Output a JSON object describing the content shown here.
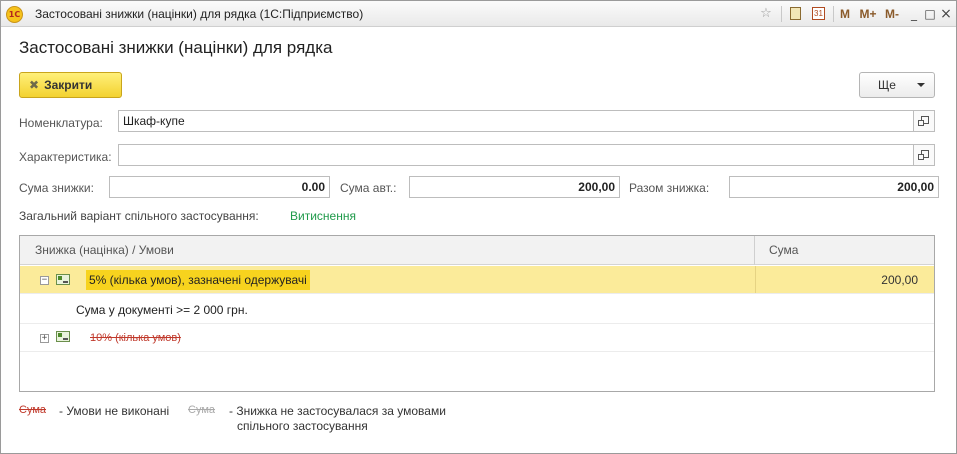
{
  "window": {
    "title": "Застосовані знижки (націнки) для рядка  (1С:Підприємство)",
    "app_logo_text": "1С",
    "toolbar": {
      "mem_m": "M",
      "mem_mplus": "M+",
      "mem_mminus": "M-",
      "minimize": "_",
      "maximize": "□",
      "close": "×",
      "calendar_day": "31"
    }
  },
  "form": {
    "title": "Застосовані знижки (націнки) для рядка",
    "close_button": "Закрити",
    "more_button": "Ще"
  },
  "fields": {
    "nomenclature_label": "Номенклатура:",
    "nomenclature_value": "Шкаф-купе",
    "characteristic_label": "Характеристика:",
    "characteristic_value": "",
    "discount_sum_label": "Сума знижки:",
    "discount_sum_value": "0.00",
    "auto_sum_label": "Сума авт.:",
    "auto_sum_value": "200,00",
    "total_discount_label": "Разом знижка:",
    "total_discount_value": "200,00",
    "joint_variant_label": "Загальний варіант спільного застосування:",
    "joint_variant_value": "Витиснення"
  },
  "table": {
    "columns": [
      "Знижка (націнка) / Умови",
      "Сума"
    ],
    "rows": [
      {
        "text": "5% (кілька умов), зазначені одержувачі",
        "sum": "200,00",
        "toggle": "−",
        "selected": true
      },
      {
        "text": "Сума у документі >= 2 000 грн.",
        "sum": ""
      },
      {
        "text": "10% (кілька умов)",
        "sum": "",
        "toggle": "+",
        "struck": true
      }
    ]
  },
  "legend": {
    "red_sample": "Сума",
    "red_text": "- Умови не виконані",
    "gray_sample": "Сума",
    "gray_text_line1": "- Знижка не застосувалася за умовами",
    "gray_text_line2": "спільного застосування"
  },
  "colors": {
    "accent_yellow": "#f3d230",
    "selection": "#fbeb9a",
    "highlight": "#f7d31e",
    "link_green": "#1f9a4a",
    "error_red": "#c0392b"
  }
}
